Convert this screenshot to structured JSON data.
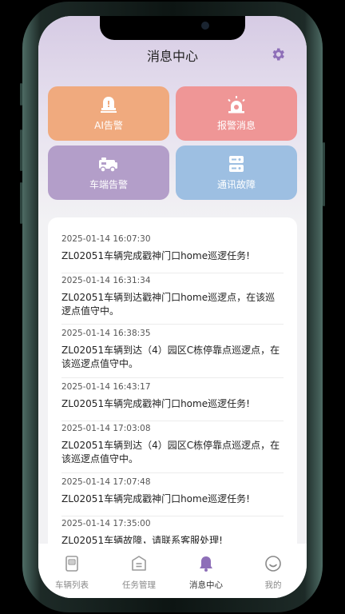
{
  "header": {
    "title": "消息中心"
  },
  "tiles": [
    {
      "label": "AI告警",
      "color": "#f0aa7e",
      "icon": "bell-alert-icon"
    },
    {
      "label": "报警消息",
      "color": "#ef9696",
      "icon": "siren-icon"
    },
    {
      "label": "车端告警",
      "color": "#b39ec9",
      "icon": "vehicle-icon"
    },
    {
      "label": "通讯故障",
      "color": "#9dbfe2",
      "icon": "server-icon"
    }
  ],
  "messages": [
    {
      "time": "2025-01-14 16:07:30",
      "text": "ZL02051车辆完成戳神门口home巡逻任务!"
    },
    {
      "time": "2025-01-14 16:31:34",
      "text": "ZL02051车辆到达戳神门口home巡逻点，在该巡逻点值守中。"
    },
    {
      "time": "2025-01-14 16:38:35",
      "text": "ZL02051车辆到达（4）园区C栋停靠点巡逻点，在该巡逻点值守中。"
    },
    {
      "time": "2025-01-14 16:43:17",
      "text": "ZL02051车辆完成戳神门口home巡逻任务!"
    },
    {
      "time": "2025-01-14 17:03:08",
      "text": "ZL02051车辆到达（4）园区C栋停靠点巡逻点，在该巡逻点值守中。"
    },
    {
      "time": "2025-01-14 17:07:48",
      "text": "ZL02051车辆完成戳神门口home巡逻任务!"
    },
    {
      "time": "2025-01-14 17:35:00",
      "text": "ZL02051车辆故障，请联系客服处理!"
    }
  ],
  "tabs": [
    {
      "label": "车辆列表",
      "icon": "vehicle-list-icon"
    },
    {
      "label": "任务管理",
      "icon": "task-icon"
    },
    {
      "label": "消息中心",
      "icon": "bell-icon"
    },
    {
      "label": "我的",
      "icon": "smiley-icon"
    }
  ],
  "colors": {
    "accent": "#8e6fb8",
    "inactive": "#8a8a8a"
  }
}
